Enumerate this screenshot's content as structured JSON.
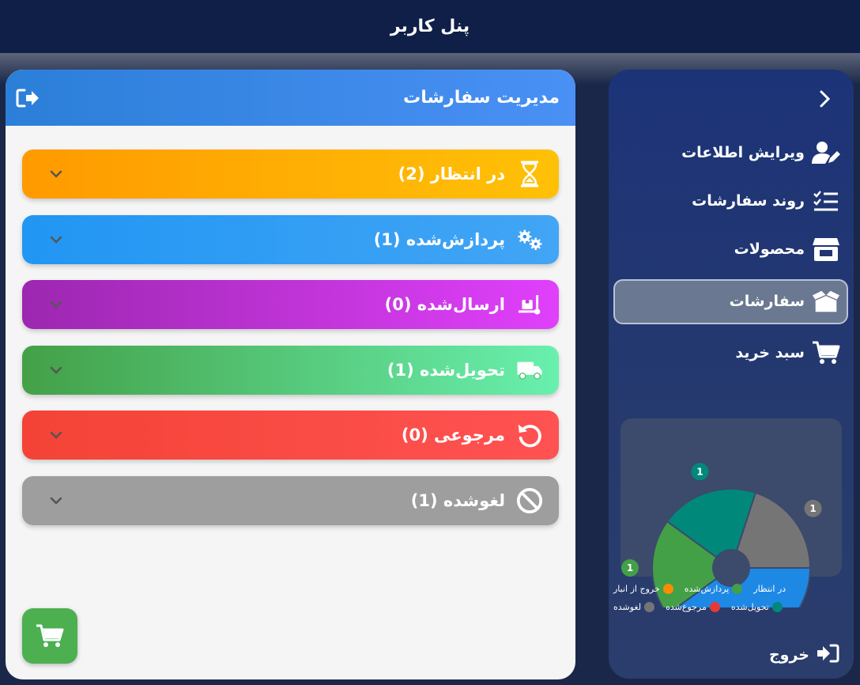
{
  "app": {
    "title": "پنل کاربر"
  },
  "main": {
    "title": "مدیریت سفارشات",
    "statuses": [
      {
        "label": "در انتظار (2)",
        "icon": "hourglass-icon"
      },
      {
        "label": "پردازش‌شده (1)",
        "icon": "gears-icon"
      },
      {
        "label": "ارسال‌شده (0)",
        "icon": "dolly-icon"
      },
      {
        "label": "تحویل‌شده (1)",
        "icon": "truck-icon"
      },
      {
        "label": "مرجوعی (0)",
        "icon": "undo-icon"
      },
      {
        "label": "لغوشده (1)",
        "icon": "ban-icon"
      }
    ]
  },
  "sidebar": {
    "items": [
      {
        "label": "ویرایش اطلاعات",
        "icon": "user-edit-icon"
      },
      {
        "label": "روند سفارشات",
        "icon": "list-check-icon"
      },
      {
        "label": "محصولات",
        "icon": "store-icon"
      },
      {
        "label": "سفارشات",
        "icon": "box-open-icon",
        "active": true
      },
      {
        "label": "سبد خرید",
        "icon": "cart-icon"
      }
    ],
    "logout": "خروج"
  },
  "chart_data": {
    "type": "pie",
    "series": [
      {
        "name": "در انتظار",
        "value": 2,
        "color": "#1e88e5"
      },
      {
        "name": "پردازش‌شده",
        "value": 1,
        "color": "#43a047"
      },
      {
        "name": "خروج از انبار",
        "value": 0,
        "color": "#fb8c00"
      },
      {
        "name": "تحویل‌شده",
        "value": 1,
        "color": "#00897b"
      },
      {
        "name": "مرجوع‌شده",
        "value": 0,
        "color": "#e53935"
      },
      {
        "name": "لغوشده",
        "value": 1,
        "color": "#757575"
      }
    ],
    "legend_position": "bottom"
  }
}
